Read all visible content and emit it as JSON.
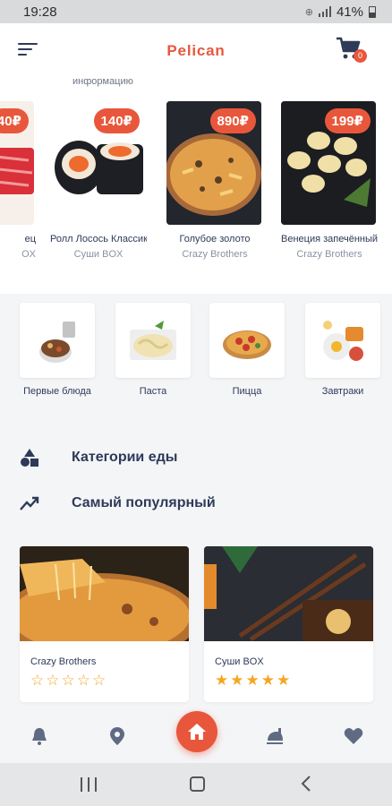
{
  "status": {
    "time": "19:28",
    "battery": "41%"
  },
  "appbar": {
    "title": "Pelican",
    "cart_count": "0"
  },
  "featured": {
    "info_label": "информацию",
    "items": [
      {
        "price": "40₽",
        "name": "ец",
        "vendor": "OX"
      },
      {
        "price": "140₽",
        "name": "Ролл Лосось Классик",
        "vendor": "Суши BOX"
      },
      {
        "price": "890₽",
        "name": "Голубое золото",
        "vendor": "Crazy Brothers"
      },
      {
        "price": "199₽",
        "name": "Венеция запечённый",
        "vendor": "Crazy Brothers"
      }
    ]
  },
  "categories": [
    {
      "label": "Первые блюда"
    },
    {
      "label": "Паста"
    },
    {
      "label": "Пицца"
    },
    {
      "label": "Завтраки"
    }
  ],
  "menu": {
    "food_categories": "Категории еды",
    "most_popular": "Самый популярный"
  },
  "popular": [
    {
      "name": "Crazy Brothers",
      "rating": 0,
      "stars_empty": "☆☆☆☆☆"
    },
    {
      "name": "Суши BOX",
      "rating": 5,
      "stars_filled": "★★★★★"
    }
  ],
  "colors": {
    "accent": "#e8573c",
    "text": "#2e3a59",
    "star": "#f5a623"
  },
  "icons": {
    "bottom_nav": [
      "bell-icon",
      "location-icon",
      "home-icon",
      "dish-icon",
      "heart-icon"
    ],
    "system_nav": [
      "recents-icon",
      "home-square-icon",
      "back-icon"
    ]
  }
}
